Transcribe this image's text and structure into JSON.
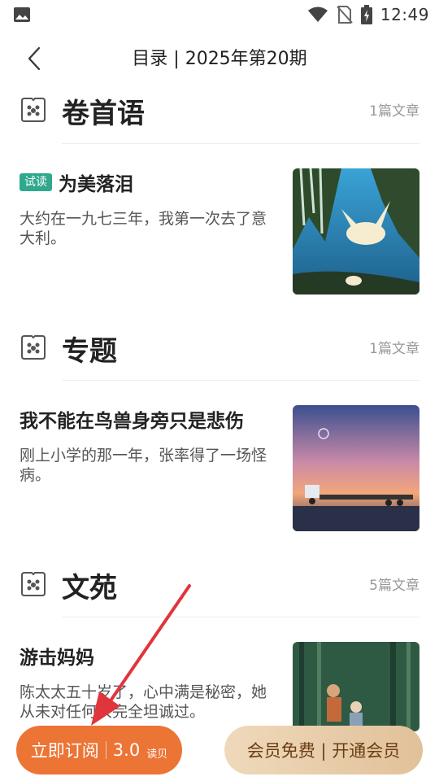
{
  "status_bar": {
    "time": "12:49",
    "icons": [
      "image-icon",
      "wifi-icon",
      "no-sim-icon",
      "battery-charging-icon"
    ]
  },
  "header": {
    "back_icon": "chevron-left-icon",
    "title": "目录 | 2025年第20期"
  },
  "sections": [
    {
      "title": "卷首语",
      "count": "1篇文章",
      "icon": "book-logo-icon",
      "articles": [
        {
          "badge": "试读",
          "title": "为美落泪",
          "summary": "大约在一九七三年，我第一次去了意大利。"
        }
      ]
    },
    {
      "title": "专题",
      "count": "1篇文章",
      "icon": "book-logo-icon",
      "articles": [
        {
          "title": "我不能在鸟兽身旁只是悲伤",
          "summary": "刚上小学的那一年，张率得了一场怪病。"
        }
      ]
    },
    {
      "title": "文苑",
      "count": "5篇文章",
      "icon": "book-logo-icon",
      "articles": [
        {
          "title": "游击妈妈",
          "summary": "陈太太五十岁了，心中满是秘密，她从未对任何人完全坦诚过。"
        }
      ]
    }
  ],
  "bottom_bar": {
    "subscribe_label": "立即订阅",
    "subscribe_price": "3.0",
    "subscribe_unit": "读贝",
    "member_label": "会员免费 | 开通会员"
  },
  "colors": {
    "accent_orange": "#ec7435",
    "badge_green": "#2fa88c",
    "member_gold": "#e8cda9",
    "annotation_red": "#e0353d"
  }
}
